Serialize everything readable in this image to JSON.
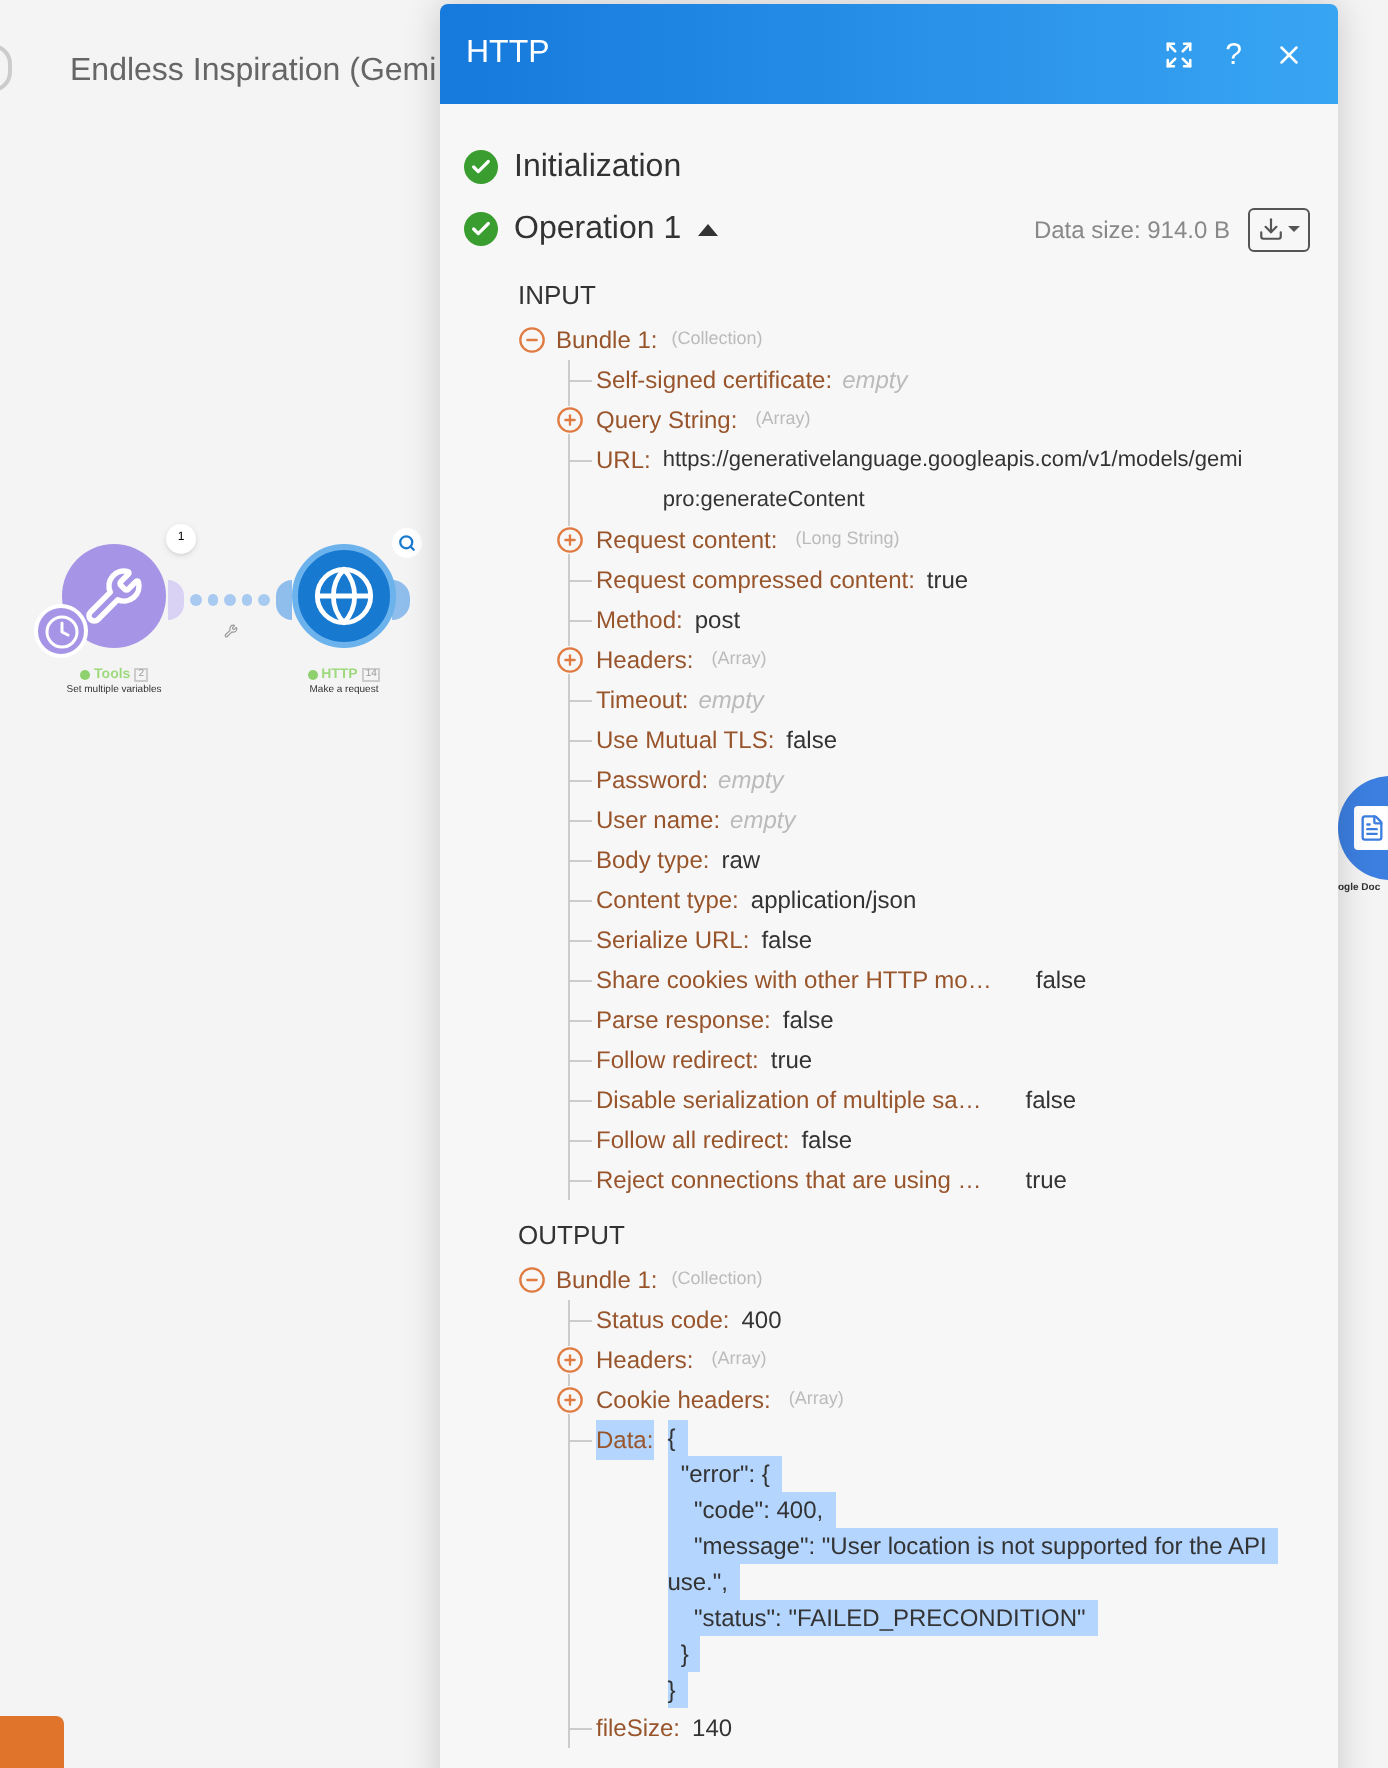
{
  "canvas": {
    "scenario_title": "Endless Inspiration (Gemi",
    "route_count": "1",
    "nodes": [
      {
        "kind": "tools",
        "name": "Tools",
        "badge": "2",
        "subtitle": "Set multiple variables",
        "success": true
      },
      {
        "kind": "http",
        "name": "HTTP",
        "badge": "14",
        "subtitle": "Make a request",
        "success": true
      },
      {
        "kind": "docs",
        "name": "ogle Doc"
      }
    ]
  },
  "panel": {
    "title": "HTTP",
    "help_label": "?",
    "steps": [
      {
        "label": "Initialization",
        "success": true
      },
      {
        "label": "Operation 1",
        "success": true,
        "expanded": true,
        "data_size": "Data size: 914.0 B"
      }
    ],
    "sections": [
      {
        "title": "INPUT",
        "bundles": [
          {
            "label": "Bundle 1:",
            "type": "(Collection)",
            "expanded": true,
            "items": [
              {
                "kind": "empty",
                "label": "Self-signed certificate:",
                "value": "empty"
              },
              {
                "kind": "group",
                "label": "Query String:",
                "type": "(Array)",
                "expanded": false
              },
              {
                "kind": "value",
                "label": "URL:",
                "value": [
                  "https://generativelanguage.googleapis.com/v1/models/gemi",
                  "pro:generateContent"
                ]
              },
              {
                "kind": "group",
                "label": "Request content:",
                "type": "(Long String)",
                "expanded": false
              },
              {
                "kind": "value",
                "label": "Request compressed content:",
                "value": "true"
              },
              {
                "kind": "value",
                "label": "Method:",
                "value": "post"
              },
              {
                "kind": "group",
                "label": "Headers:",
                "type": "(Array)",
                "expanded": false
              },
              {
                "kind": "empty",
                "label": "Timeout:",
                "value": "empty"
              },
              {
                "kind": "value",
                "label": "Use Mutual TLS:",
                "value": "false"
              },
              {
                "kind": "empty",
                "label": "Password:",
                "value": "empty"
              },
              {
                "kind": "empty",
                "label": "User name:",
                "value": "empty"
              },
              {
                "kind": "value",
                "label": "Body type:",
                "value": "raw"
              },
              {
                "kind": "value",
                "label": "Content type:",
                "value": "application/json"
              },
              {
                "kind": "value",
                "label": "Serialize URL:",
                "value": "false"
              },
              {
                "kind": "value",
                "label": "Share cookies with other HTTP mo…",
                "value": "false"
              },
              {
                "kind": "value",
                "label": "Parse response:",
                "value": "false"
              },
              {
                "kind": "value",
                "label": "Follow redirect:",
                "value": "true"
              },
              {
                "kind": "value",
                "label": "Disable serialization of multiple sa…",
                "value": "false"
              },
              {
                "kind": "value",
                "label": "Follow all redirect:",
                "value": "false"
              },
              {
                "kind": "value",
                "label": "Reject connections that are using …",
                "value": "true"
              }
            ]
          }
        ]
      },
      {
        "title": "OUTPUT",
        "bundles": [
          {
            "label": "Bundle 1:",
            "type": "(Collection)",
            "expanded": true,
            "items": [
              {
                "kind": "value",
                "label": "Status code:",
                "value": "400"
              },
              {
                "kind": "group",
                "label": "Headers:",
                "type": "(Array)",
                "expanded": false
              },
              {
                "kind": "group",
                "label": "Cookie headers:",
                "type": "(Array)",
                "expanded": false
              },
              {
                "kind": "value",
                "label": "Data:",
                "highlighted": true,
                "value": [
                  "{",
                  "  \"error\": {",
                  "    \"code\": 400,",
                  "    \"message\": \"User location is not supported for the API",
                  "use.\",",
                  "    \"status\": \"FAILED_PRECONDITION\"",
                  "  }",
                  "}"
                ]
              },
              {
                "kind": "value",
                "label": "fileSize:",
                "value": "140"
              }
            ]
          }
        ]
      }
    ]
  }
}
